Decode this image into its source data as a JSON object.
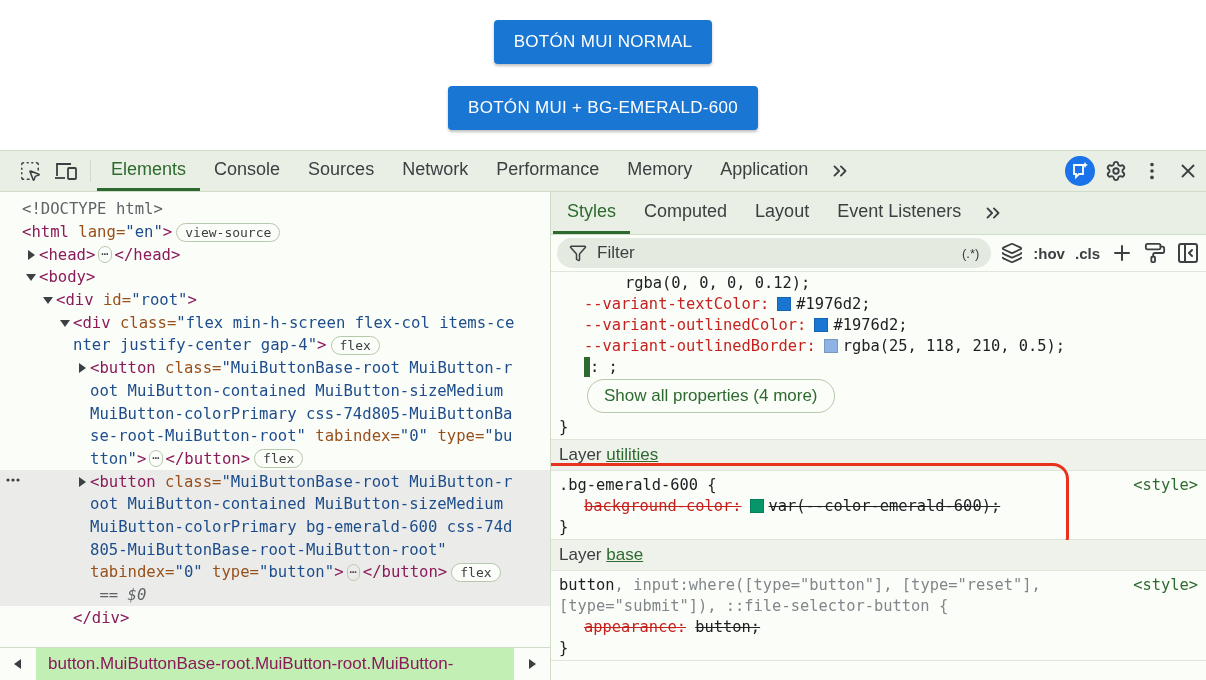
{
  "page": {
    "buttons": [
      "BOTÓN MUI NORMAL",
      "BOTÓN MUI + BG-EMERALD-600"
    ]
  },
  "devtools": {
    "tabs": [
      {
        "label": "Elements",
        "selected": true
      },
      {
        "label": "Console",
        "selected": false
      },
      {
        "label": "Sources",
        "selected": false
      },
      {
        "label": "Network",
        "selected": false
      },
      {
        "label": "Performance",
        "selected": false
      },
      {
        "label": "Memory",
        "selected": false
      },
      {
        "label": "Application",
        "selected": false
      }
    ]
  },
  "elements": {
    "tree": [
      {
        "lines": [
          [
            {
              "kind": "plain",
              "t": "<!DOCTYPE html>"
            }
          ]
        ]
      },
      {
        "lines": [
          [
            {
              "kind": "tag",
              "t": "<html "
            },
            {
              "kind": "attr",
              "t": "lang="
            },
            {
              "kind": "val",
              "t": "\"en\""
            },
            {
              "kind": "tag",
              "t": ">"
            },
            {
              "kind": "badge",
              "t": "view-source"
            }
          ]
        ],
        "children": [
          {
            "expanded": false,
            "lines": [
              [
                {
                  "kind": "tag",
                  "t": "<head>"
                },
                {
                  "kind": "dots",
                  "t": "⋯"
                },
                {
                  "kind": "tag",
                  "t": "</head>"
                }
              ]
            ]
          },
          {
            "expanded": true,
            "lines": [
              [
                {
                  "kind": "tag",
                  "t": "<body>"
                }
              ]
            ],
            "children": [
              {
                "expanded": true,
                "lines": [
                  [
                    {
                      "kind": "tag",
                      "t": "<div "
                    },
                    {
                      "kind": "attr",
                      "t": "id="
                    },
                    {
                      "kind": "val",
                      "t": "\"root\""
                    },
                    {
                      "kind": "tag",
                      "t": ">"
                    }
                  ]
                ],
                "children": [
                  {
                    "expanded": true,
                    "close": "</div>",
                    "lines": [
                      [
                        {
                          "kind": "tag",
                          "t": "<div "
                        },
                        {
                          "kind": "attr",
                          "t": "class="
                        },
                        {
                          "kind": "val",
                          "t": "\"flex min-h-screen flex-col items-ce"
                        }
                      ],
                      [
                        {
                          "kind": "val",
                          "t": "nter justify-center gap-4\""
                        },
                        {
                          "kind": "tag",
                          "t": ">"
                        },
                        {
                          "kind": "badge",
                          "t": "flex"
                        }
                      ]
                    ],
                    "children": [
                      {
                        "expanded": false,
                        "selected": false,
                        "lines": [
                          [
                            {
                              "kind": "tag",
                              "t": "<button "
                            },
                            {
                              "kind": "attr",
                              "t": "class="
                            },
                            {
                              "kind": "val",
                              "t": "\"MuiButtonBase-root MuiButton-r"
                            }
                          ],
                          [
                            {
                              "kind": "val",
                              "t": "oot MuiButton-contained MuiButton-sizeMedium"
                            }
                          ],
                          [
                            {
                              "kind": "val",
                              "t": "MuiButton-colorPrimary css-74d805-MuiButtonBa"
                            }
                          ],
                          [
                            {
                              "kind": "val",
                              "t": "se-root-MuiButton-root\""
                            },
                            {
                              "kind": "attr",
                              "t": " tabindex="
                            },
                            {
                              "kind": "val",
                              "t": "\"0\""
                            },
                            {
                              "kind": "attr",
                              "t": " type="
                            },
                            {
                              "kind": "val",
                              "t": "\"bu"
                            }
                          ],
                          [
                            {
                              "kind": "val",
                              "t": "tton\""
                            },
                            {
                              "kind": "tag",
                              "t": ">"
                            },
                            {
                              "kind": "dots",
                              "t": "⋯"
                            },
                            {
                              "kind": "tag",
                              "t": "</button>"
                            },
                            {
                              "kind": "badge",
                              "t": "flex"
                            }
                          ]
                        ]
                      },
                      {
                        "expanded": false,
                        "selected": true,
                        "lines": [
                          [
                            {
                              "kind": "tag",
                              "t": "<button "
                            },
                            {
                              "kind": "attr",
                              "t": "class="
                            },
                            {
                              "kind": "val",
                              "t": "\"MuiButtonBase-root MuiButton-r"
                            }
                          ],
                          [
                            {
                              "kind": "val",
                              "t": "oot MuiButton-contained MuiButton-sizeMedium"
                            }
                          ],
                          [
                            {
                              "kind": "val",
                              "t": "MuiButton-colorPrimary bg-emerald-600 css-74d"
                            }
                          ],
                          [
                            {
                              "kind": "val",
                              "t": "805-MuiButtonBase-root-MuiButton-root\""
                            }
                          ],
                          [
                            {
                              "kind": "attr",
                              "t": "tabindex="
                            },
                            {
                              "kind": "val",
                              "t": "\"0\""
                            },
                            {
                              "kind": "attr",
                              "t": " type="
                            },
                            {
                              "kind": "val",
                              "t": "\"button\""
                            },
                            {
                              "kind": "tag",
                              "t": ">"
                            },
                            {
                              "kind": "dots",
                              "t": "⋯"
                            },
                            {
                              "kind": "tag",
                              "t": "</button>"
                            },
                            {
                              "kind": "badge",
                              "t": "flex"
                            }
                          ],
                          [
                            {
                              "kind": "dollar",
                              "t": " == $0"
                            }
                          ]
                        ]
                      }
                    ]
                  }
                ]
              }
            ]
          }
        ]
      }
    ],
    "breadcrumb": "button.MuiButtonBase-root.MuiButton-root.MuiButton-"
  },
  "styles": {
    "tabs": [
      {
        "label": "Styles",
        "selected": true
      },
      {
        "label": "Computed",
        "selected": false
      },
      {
        "label": "Layout",
        "selected": false
      },
      {
        "label": "Event Listeners",
        "selected": false
      }
    ],
    "filter": {
      "placeholder": "Filter",
      "regex": "(.*)"
    },
    "toggles": [
      ":hov",
      ".cls"
    ],
    "rules": [
      {
        "highlighted": false,
        "lines": [
          {
            "kind": "continuation",
            "value": "rgba(0, 0, 0, 0.12);"
          },
          {
            "kind": "prop",
            "name": "--variant-textColor:",
            "value": "#1976d2;",
            "color": "#1976d2",
            "overridden": false
          },
          {
            "kind": "prop",
            "name": "--variant-outlinedColor:",
            "value": "#1976d2;",
            "color": "#1976d2",
            "overridden": false
          },
          {
            "kind": "prop",
            "name": "--variant-outlinedBorder:",
            "value": "rgba(25, 118, 210, 0.5);",
            "color": "#8cb3e3",
            "overridden": false
          },
          {
            "kind": "editing",
            "value": ": ;"
          }
        ],
        "more_button": "Show all properties (4 more)",
        "close": "}"
      },
      {
        "layer": "Layer",
        "layer_name": "utilities",
        "highlighted": true,
        "selector": [
          [
            {
              "t": ".bg-emerald-600 {",
              "match": true
            }
          ]
        ],
        "source": "<style>",
        "lines": [
          {
            "kind": "prop",
            "name": "background-color:",
            "value": "var(--color-emerald-600);",
            "color": "#059669",
            "overridden": true
          }
        ],
        "close": "}"
      },
      {
        "layer": "Layer",
        "layer_name": "base",
        "highlighted": false,
        "selector": [
          [
            {
              "t": "button",
              "match": true
            },
            {
              "t": ", input:where([type=\"button\"], [type=\"reset\"],",
              "match": false
            }
          ],
          [
            {
              "t": "[type=\"submit\"]), ::file-selector-button {",
              "match": false
            }
          ]
        ],
        "source": "<style>",
        "lines": [
          {
            "kind": "prop",
            "name": "appearance:",
            "value": "button;",
            "overridden": true
          }
        ],
        "close": "}"
      }
    ]
  }
}
